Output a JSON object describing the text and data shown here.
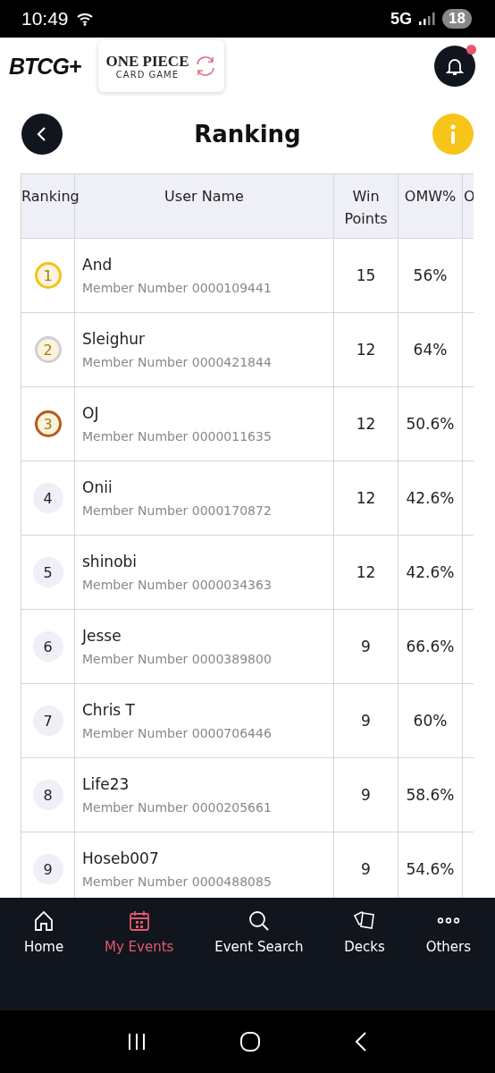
{
  "status_bar": {
    "time": "10:49",
    "network": "5G",
    "battery": "18"
  },
  "header": {
    "app_logo": "BTCG+",
    "game_logo": {
      "title": "ONE PIECE",
      "subtitle": "CARD GAME"
    },
    "notification_dot": true
  },
  "title": "Ranking",
  "table": {
    "columns": [
      "Ranking",
      "User Name",
      "Win Points",
      "OMW%",
      "O"
    ],
    "rows": [
      {
        "rank": "1",
        "color": "#f4c21a",
        "name": "And",
        "member": "Member Number 0000109441",
        "win_points": "15",
        "omw": "56%"
      },
      {
        "rank": "2",
        "color": "#cfcfd6",
        "name": "Sleighur",
        "member": "Member Number 0000421844",
        "win_points": "12",
        "omw": "64%"
      },
      {
        "rank": "3",
        "color": "#b45a1c",
        "name": "OJ",
        "member": "Member Number 0000011635",
        "win_points": "12",
        "omw": "50.6%"
      },
      {
        "rank": "4",
        "color": "#efeff7",
        "name": "Onii",
        "member": "Member Number 0000170872",
        "win_points": "12",
        "omw": "42.6%"
      },
      {
        "rank": "5",
        "color": "#efeff7",
        "name": "shinobi",
        "member": "Member Number 0000034363",
        "win_points": "12",
        "omw": "42.6%"
      },
      {
        "rank": "6",
        "color": "#efeff7",
        "name": "Jesse",
        "member": "Member Number 0000389800",
        "win_points": "9",
        "omw": "66.6%"
      },
      {
        "rank": "7",
        "color": "#efeff7",
        "name": "Chris T",
        "member": "Member Number 0000706446",
        "win_points": "9",
        "omw": "60%"
      },
      {
        "rank": "8",
        "color": "#efeff7",
        "name": "Life23",
        "member": "Member Number 0000205661",
        "win_points": "9",
        "omw": "58.6%"
      },
      {
        "rank": "9",
        "color": "#efeff7",
        "name": "Hoseb007",
        "member": "Member Number 0000488085",
        "win_points": "9",
        "omw": "54.6%"
      }
    ]
  },
  "nav": [
    {
      "kind": "home",
      "label": "Home",
      "selected": false
    },
    {
      "kind": "events",
      "label": "My Events",
      "selected": true
    },
    {
      "kind": "search",
      "label": "Event Search",
      "selected": false
    },
    {
      "kind": "decks",
      "label": "Decks",
      "selected": false
    },
    {
      "kind": "others",
      "label": "Others",
      "selected": false
    }
  ]
}
